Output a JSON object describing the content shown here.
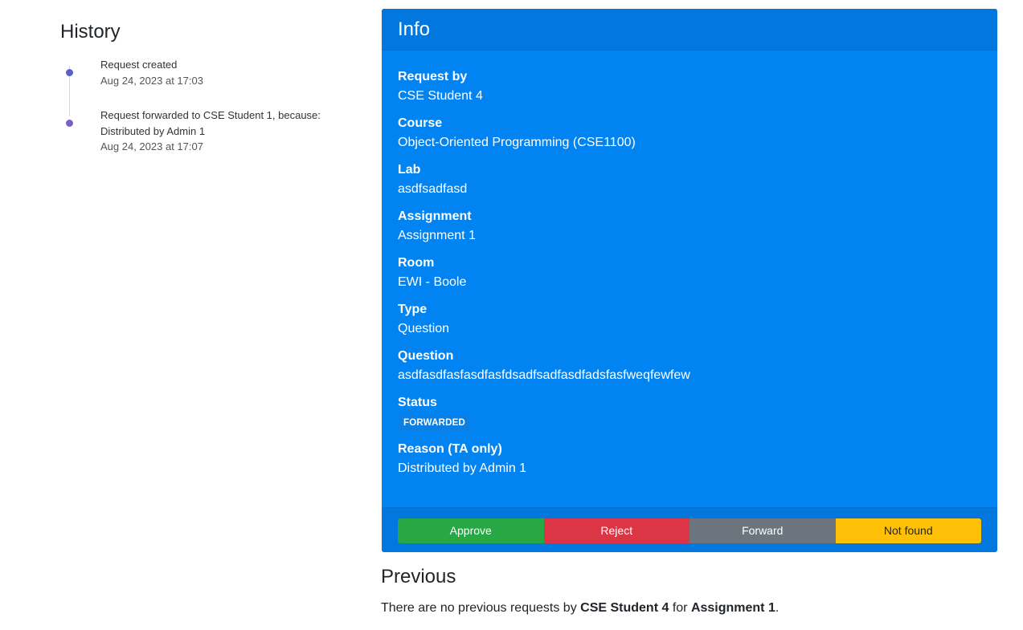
{
  "history": {
    "title": "History",
    "items": [
      {
        "text": "Request created",
        "date": "Aug 24, 2023 at 17:03",
        "dot_color": "#5b5fc7"
      },
      {
        "text": "Request forwarded to CSE Student 1, because:",
        "text2": "Distributed by Admin 1",
        "date": "Aug 24, 2023 at 17:07",
        "dot_color": "#7b5fc4"
      }
    ]
  },
  "info": {
    "title": "Info",
    "fields": [
      {
        "label": "Request by",
        "value": "CSE Student 4"
      },
      {
        "label": "Course",
        "value": "Object-Oriented Programming (CSE1100)"
      },
      {
        "label": "Lab",
        "value": "asdfsadfasd"
      },
      {
        "label": "Assignment",
        "value": "Assignment 1"
      },
      {
        "label": "Room",
        "value": "EWI - Boole"
      },
      {
        "label": "Type",
        "value": "Question"
      },
      {
        "label": "Question",
        "value": "asdfasdfasfasdfasfdsadfsadfasdfadsfasfweqfewfew"
      },
      {
        "label": "Status",
        "value": "FORWARDED"
      },
      {
        "label": "Reason (TA only)",
        "value": "Distributed by Admin 1"
      }
    ],
    "status_badge_color": "#0b7fe3",
    "actions": {
      "approve": "Approve",
      "reject": "Reject",
      "forward": "Forward",
      "not_found": "Not found"
    },
    "colors": {
      "card": "#0283f2",
      "approve": "#28a745",
      "reject": "#dc3545",
      "forward": "#6c757d",
      "not_found": "#ffc107"
    }
  },
  "previous": {
    "title": "Previous",
    "text_before": "There are no previous requests by ",
    "student": "CSE Student 4",
    "text_mid": " for ",
    "assignment": "Assignment 1",
    "text_after": "."
  }
}
